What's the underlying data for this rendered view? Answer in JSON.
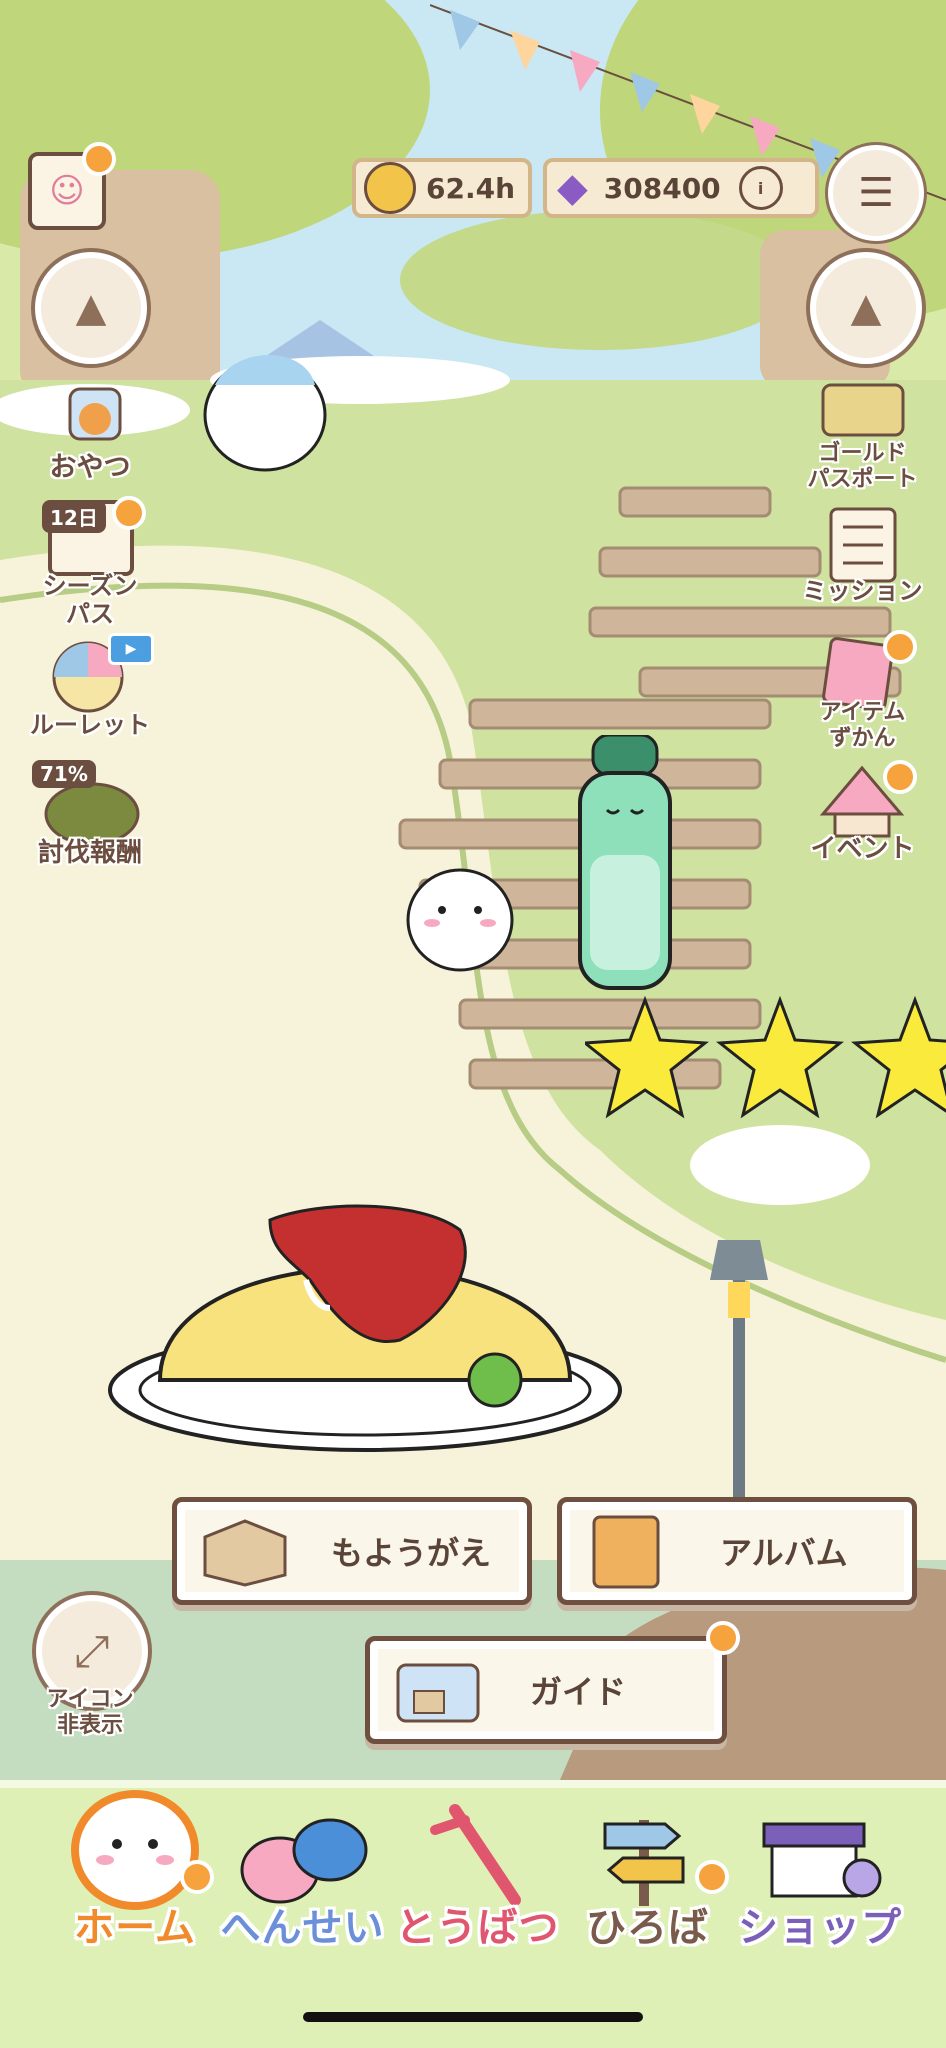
{
  "currency": {
    "coins_value": "62.4h",
    "gems_value": "308400"
  },
  "left_menu": {
    "snack_label": "おやつ",
    "season_days": "12日",
    "season_label_line1": "シーズン",
    "season_label_line2": "パス",
    "roulette_label": "ルーレット",
    "reward_percent": "71%",
    "reward_label": "討伐報酬"
  },
  "right_menu": {
    "gold_label_line1": "ゴールド",
    "gold_label_line2": "パスポート",
    "mission_label": "ミッション",
    "item_label_line1": "アイテム",
    "item_label_line2": "ずかん",
    "event_label": "イベント"
  },
  "action_buttons": {
    "moyougae_label": "もようがえ",
    "album_label": "アルバム",
    "guide_label": "ガイド"
  },
  "hide_icons": {
    "line1": "アイコン",
    "line2": "非表示"
  },
  "bottom_nav": {
    "home_label": "ホーム",
    "formation_label": "へんせい",
    "subjugation_label": "とうばつ",
    "plaza_label": "ひろば",
    "shop_label": "ショップ"
  },
  "colors": {
    "home_label": "#f08a2a",
    "formation_label": "#6b8fd9",
    "subjugation_label": "#e0566f",
    "plaza_label": "#7a5a4a",
    "shop_label": "#7b5fb8"
  }
}
